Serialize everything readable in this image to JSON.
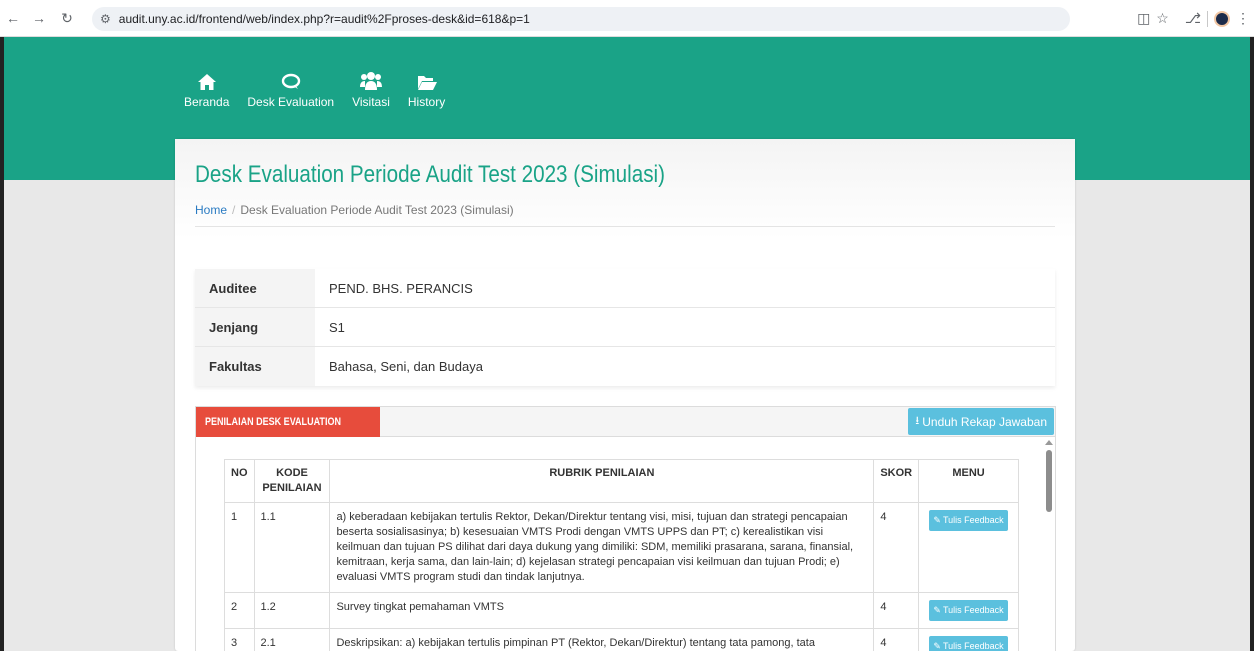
{
  "browser": {
    "url": "audit.uny.ac.id/frontend/web/index.php?r=audit%2Fproses-desk&id=618&p=1"
  },
  "nav": {
    "items": [
      {
        "label": "Beranda",
        "icon": "home-icon"
      },
      {
        "label": "Desk Evaluation",
        "icon": "chat-icon"
      },
      {
        "label": "Visitasi",
        "icon": "users-icon"
      },
      {
        "label": "History",
        "icon": "folder-open-icon"
      }
    ]
  },
  "page": {
    "title": "Desk Evaluation Periode Audit Test 2023 (Simulasi)",
    "breadcrumb_home": "Home",
    "breadcrumb_current": "Desk Evaluation Periode Audit Test 2023 (Simulasi)"
  },
  "info": {
    "rows": [
      {
        "label": "Auditee",
        "value": "PEND. BHS. PERANCIS"
      },
      {
        "label": "Jenjang",
        "value": "S1"
      },
      {
        "label": "Fakultas",
        "value": "Bahasa, Seni, dan Budaya"
      }
    ]
  },
  "panel": {
    "tab_label": "PENILAIAN DESK EVALUATION",
    "download_label": "Unduh Rekap Jawaban"
  },
  "table": {
    "headers": {
      "no": "NO",
      "kode": "KODE PENILAIAN",
      "rubrik": "RUBRIK PENILAIAN",
      "skor": "SKOR",
      "menu": "MENU"
    },
    "feedback_label": "Tulis Feedback",
    "rows": [
      {
        "no": "1",
        "kode": "1.1",
        "rubrik": "a) keberadaan kebijakan tertulis Rektor, Dekan/Direktur tentang visi, misi, tujuan dan strategi pencapaian beserta sosialisasinya; b) kesesuaian VMTS Prodi dengan VMTS UPPS dan PT; c) kerealistikan visi keilmuan dan tujuan PS dilihat dari daya dukung yang dimiliki: SDM, memiliki prasarana, sarana, finansial, kemitraan, kerja sama, dan lain-lain; d) kejelasan strategi pencapaian visi keilmuan dan tujuan Prodi; e) evaluasi VMTS program studi dan tindak lanjutnya.",
        "skor": "4"
      },
      {
        "no": "2",
        "kode": "1.2",
        "rubrik": "Survey tingkat pemahaman VMTS",
        "skor": "4"
      },
      {
        "no": "3",
        "kode": "2.1",
        "rubrik": "Deskripsikan: a) kebijakan tertulis pimpinan PT (Rektor, Dekan/Direktur) tentang tata pamong, tata",
        "skor": "4"
      }
    ]
  }
}
